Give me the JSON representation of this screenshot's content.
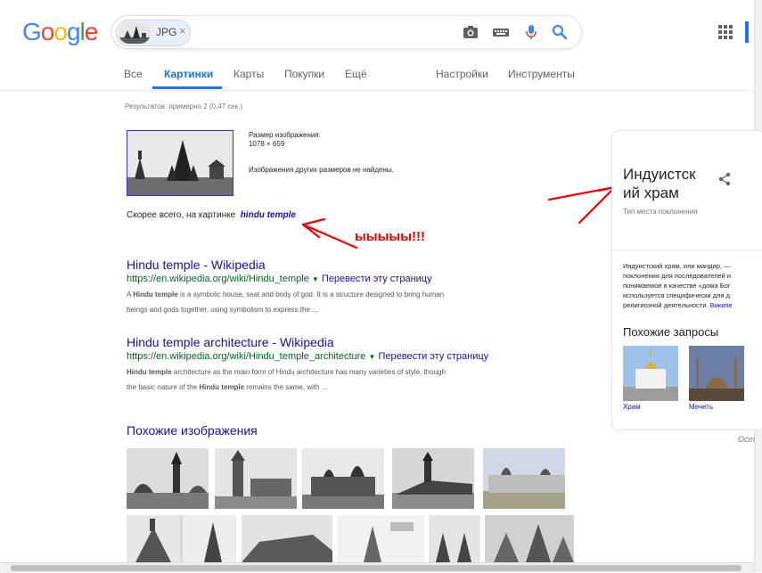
{
  "logo": {
    "letters": [
      "G",
      "o",
      "o",
      "g",
      "l",
      "e"
    ],
    "colors": [
      "#4285f4",
      "#ea4335",
      "#fbbc05",
      "#4285f4",
      "#34a853",
      "#ea4335"
    ]
  },
  "search": {
    "chip_label": "JPG",
    "chip_close": "×"
  },
  "tabs": [
    {
      "label": "Все",
      "active": false
    },
    {
      "label": "Картинки",
      "active": true
    },
    {
      "label": "Карты",
      "active": false
    },
    {
      "label": "Покупки",
      "active": false
    },
    {
      "label": "Ещё",
      "active": false
    },
    {
      "label": "Настройки",
      "active": false
    },
    {
      "label": "Инструменты",
      "active": false
    }
  ],
  "stats": "Результатов: примерно 2 (0,47 сек.)",
  "image_info": {
    "size_label": "Размер изображения:",
    "size_value": "1078 × 659",
    "no_other_sizes": "Изображения других размеров не найдены."
  },
  "best_guess": {
    "prefix": "Скорее всего, на картинке",
    "link": "hindu temple"
  },
  "annotation": "ыыыыы!!!",
  "results": [
    {
      "title": "Hindu temple - Wikipedia",
      "url": "https://en.wikipedia.org/wiki/Hindu_temple",
      "translate": "Перевести эту страницу",
      "snippet_line1_b": "Hindu temple",
      "snippet_line1_pre": "A ",
      "snippet_line1_post": " is a symbolic house, seat and body of god. It is a structure designed to bring human",
      "snippet_line2": "beings and gods together, using symbolism to express the ..."
    },
    {
      "title": "Hindu temple architecture - Wikipedia",
      "url": "https://en.wikipedia.org/wiki/Hindu_temple_architecture",
      "translate": "Перевести эту страницу",
      "snippet_line1_b": "Hindu temple",
      "snippet_line1_pre": "",
      "snippet_line1_post": " architecture as the main form of Hindu architecture has many varieties of style, though",
      "snippet_line2_pre": "the basic nature of the ",
      "snippet_line2_b": "Hindu temple",
      "snippet_line2_post": " remains the same, with ..."
    }
  ],
  "similar_heading": "Похожие изображения",
  "knowledge_panel": {
    "title": "Индуистский храм",
    "title_line1": "Индуистск",
    "title_line2": "ий храм",
    "subtitle": "Тип места поклонения",
    "desc_lines": [
      "Индуистский храм, или мандир, —",
      "поклонения для последователей и",
      "понимаемое в качестве «дома Бог",
      "используется специфически для д",
      "религиозной деятельности."
    ],
    "wiki_link": "Википе",
    "related_heading": "Похожие запросы",
    "related": [
      {
        "label": "Храм"
      },
      {
        "label": "Мечеть"
      }
    ]
  },
  "feedback": "Оставить отзыв"
}
